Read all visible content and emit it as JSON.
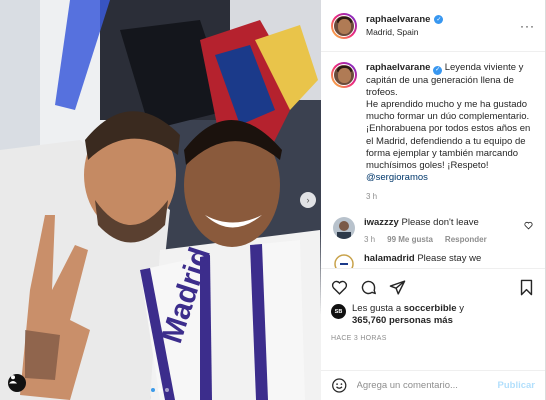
{
  "post": {
    "username": "raphaelvarane",
    "location": "Madrid, Spain",
    "more_icon": "more-horizontal-icon",
    "caption": {
      "text_1": "Leyenda viviente y capitán de una generación llena de trofeos.",
      "text_2": "He aprendido mucho y me ha gustado mucho formar un dúo complementario. ¡Enhorabuena por todos estos años en el Madrid, defendiendo a tu equipo de forma ejemplar y también marcando muchísimos goles! ¡Respeto!",
      "mention": "@sergioramos",
      "time": "3 h"
    },
    "comments": [
      {
        "username": "iwazzzy",
        "text": "Please don't leave",
        "time": "3 h",
        "likes": "99 Me gusta",
        "reply": "Responder"
      },
      {
        "username": "halamadrid",
        "text": "Please stay we"
      }
    ],
    "likes": {
      "prefix": "Les gusta a",
      "liker": "soccerbible",
      "connector": "y",
      "count": "365,760 personas más"
    },
    "date": "HACE 3 HORAS",
    "add_comment": {
      "placeholder": "Agrega un comentario...",
      "publish": "Publicar"
    },
    "mini_avatar_text": "SB"
  },
  "photo": {
    "scarf_text": "Madrid",
    "carousel_index": 1,
    "carousel_count": 3
  },
  "colors": {
    "verified": "#3897f0",
    "link": "#00376b",
    "publish_disabled": "#b2dffc",
    "meta_gray": "#8e8e8e"
  }
}
